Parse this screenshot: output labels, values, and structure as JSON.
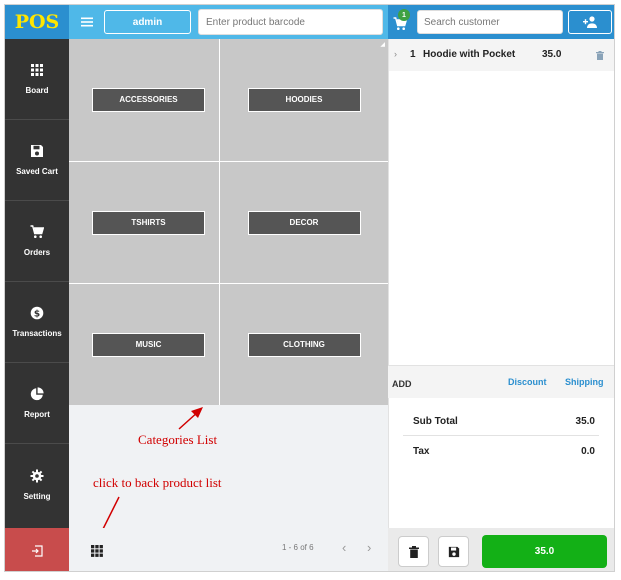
{
  "app": {
    "logo": "POS"
  },
  "sidebar": {
    "items": [
      {
        "label": "Board",
        "icon": "grid-icon"
      },
      {
        "label": "Saved Cart",
        "icon": "save-icon"
      },
      {
        "label": "Orders",
        "icon": "cart-icon"
      },
      {
        "label": "Transactions",
        "icon": "dollar-icon"
      },
      {
        "label": "Report",
        "icon": "pie-chart-icon"
      },
      {
        "label": "Setting",
        "icon": "gear-icon"
      }
    ],
    "logout_icon": "logout-icon"
  },
  "topbar": {
    "user_label": "admin",
    "barcode_placeholder": "Enter product barcode"
  },
  "categories": [
    "ACCESSORIES",
    "HOODIES",
    "TSHIRTS",
    "DECOR",
    "MUSIC",
    "CLOTHING"
  ],
  "annotations": {
    "categories_list": "Categories List",
    "back_hint": "click to back product list"
  },
  "pager": {
    "range_text": "1 - 6 of 6"
  },
  "cart": {
    "badge_count": "1",
    "search_placeholder": "Search customer",
    "items": [
      {
        "qty": "1",
        "name": "Hoodie with Pocket",
        "price": "35.0"
      }
    ],
    "add_label": "ADD",
    "discount_label": "Discount",
    "shipping_label": "Shipping",
    "subtotal_label": "Sub Total",
    "subtotal_value": "35.0",
    "tax_label": "Tax",
    "tax_value": "0.0",
    "pay_label": "35.0"
  },
  "colors": {
    "sidebar": "#333333",
    "accent_blue": "#2b8fcf",
    "topbar_light_blue": "#4fb8e8",
    "logo_yellow": "#ffe600",
    "logout_red": "#c84c4c",
    "pay_green": "#13b016",
    "annotation_red": "#d10000"
  }
}
